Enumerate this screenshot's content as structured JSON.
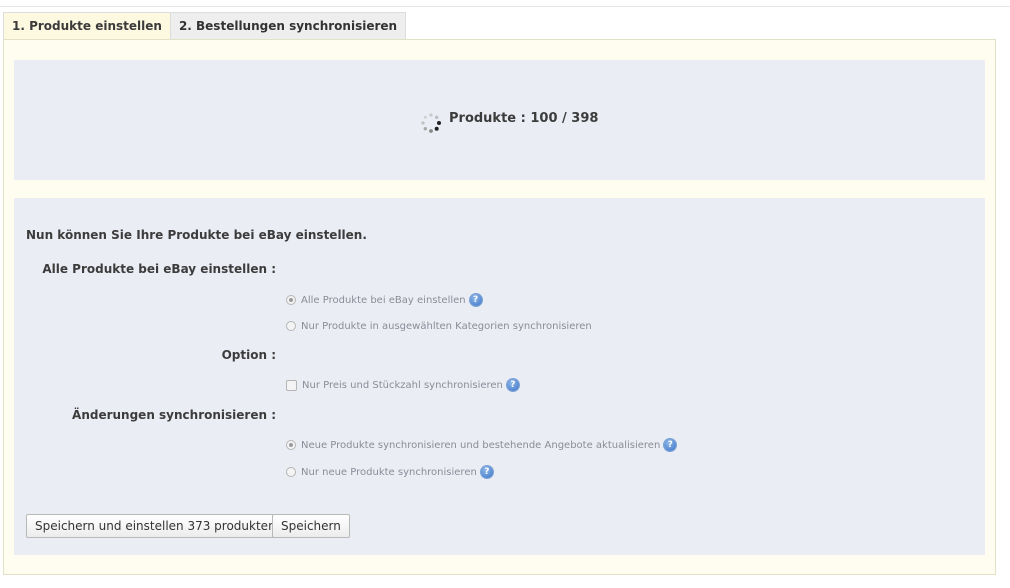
{
  "tabs": [
    {
      "label": "1. Produkte einstellen",
      "active": true
    },
    {
      "label": "2. Bestellungen synchronisieren",
      "active": false
    }
  ],
  "progress": {
    "text": "Produkte : 100 / 398",
    "current": 100,
    "total": 398,
    "icon": "loading-spinner-icon"
  },
  "form": {
    "intro": "Nun können Sie Ihre Produkte bei eBay einstellen.",
    "section_all": {
      "label": "Alle Produkte bei eBay einstellen :",
      "options": [
        {
          "label": "Alle Produkte bei eBay einstellen",
          "selected": true,
          "help": true
        },
        {
          "label": "Nur Produkte in ausgewählten Kategorien synchronisieren",
          "selected": false,
          "help": false
        }
      ]
    },
    "section_option": {
      "label": "Option :",
      "checkbox": {
        "label": "Nur Preis und Stückzahl synchronisieren",
        "checked": false,
        "help": true
      }
    },
    "section_changes": {
      "label": "Änderungen synchronisieren :",
      "options": [
        {
          "label": "Neue Produkte synchronisieren und bestehende Angebote aktualisieren",
          "selected": true,
          "help": true
        },
        {
          "label": "Nur neue Produkte synchronisieren",
          "selected": false,
          "help": true
        }
      ]
    },
    "buttons": {
      "save_and_list": "Speichern und einstellen 373 produkten",
      "save": "Speichern"
    }
  },
  "colors": {
    "active_tab_bg": "#fdf8e0",
    "panel_bg": "#ebedf4",
    "help_icon": "#3a72c4"
  }
}
